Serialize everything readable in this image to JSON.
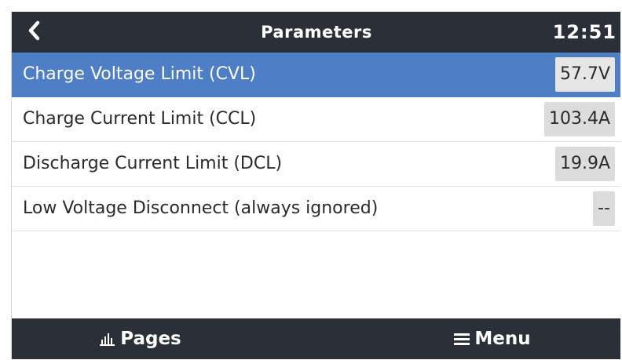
{
  "header": {
    "title": "Parameters",
    "time": "12:51"
  },
  "rows": [
    {
      "label": "Charge Voltage Limit (CVL)",
      "value": "57.7V",
      "selected": true
    },
    {
      "label": "Charge Current Limit (CCL)",
      "value": "103.4A"
    },
    {
      "label": "Discharge Current Limit (DCL)",
      "value": "19.9A"
    },
    {
      "label": "Low Voltage Disconnect (always ignored)",
      "value": "--"
    }
  ],
  "footer": {
    "pages_label": "Pages",
    "menu_label": "Menu"
  },
  "colors": {
    "header_bg": "#2a2f38",
    "selected_bg": "#4d7ec6",
    "value_bg": "#dcdcdc"
  },
  "icons": {
    "back": "back-chevron-icon",
    "pages": "bar-chart-icon",
    "menu": "hamburger-icon"
  }
}
